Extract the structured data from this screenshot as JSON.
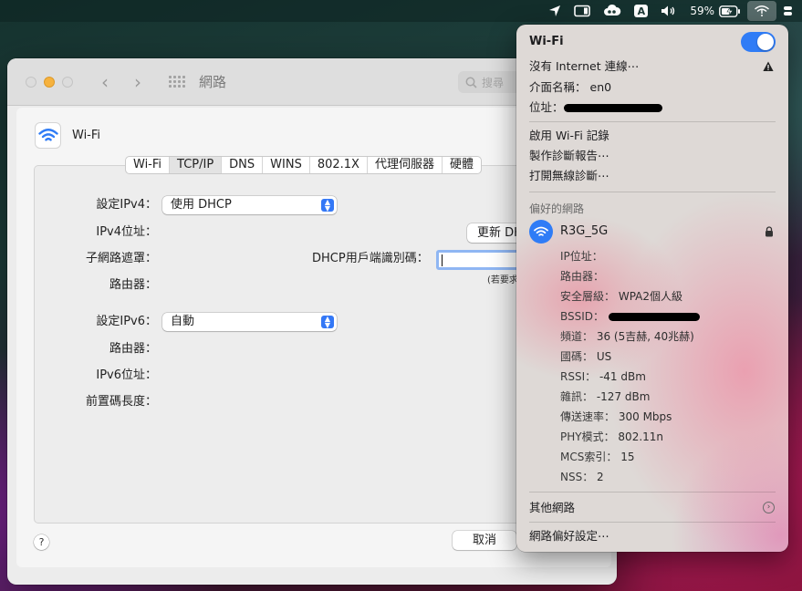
{
  "menubar": {
    "location_icon": "location-arrow-icon",
    "sidecar_icon": "sidecar-icon",
    "creative_cloud_icon": "creative-cloud-icon",
    "input_source": "A",
    "volume_icon": "speaker-icon",
    "battery_percent": "59%",
    "battery_icon": "battery-charging-icon",
    "wifi_icon": "wifi-warning-icon",
    "control_center_icon": "control-center-icon"
  },
  "window": {
    "title": "網路",
    "search_placeholder": "搜尋",
    "service_name": "Wi-Fi",
    "tabs": [
      "Wi-Fi",
      "TCP/IP",
      "DNS",
      "WINS",
      "802.1X",
      "代理伺服器",
      "硬體"
    ],
    "selected_tab": "TCP/IP",
    "ipv4_config_label": "設定IPv4：",
    "ipv4_config_value": "使用 DHCP",
    "ipv4_address_label": "IPv4位址：",
    "subnet_mask_label": "子網路遮罩：",
    "router_label": "路由器：",
    "renew_button": "更新 DHCP 租約",
    "dhcp_client_id_label": "DHCP用戶端識別碼：",
    "dhcp_client_id_value": "",
    "dhcp_hint": "(若要求)",
    "ipv6_config_label": "設定IPv6：",
    "ipv6_config_value": "自動",
    "ipv6_router_label": "路由器：",
    "ipv6_address_label": "IPv6位址：",
    "prefix_length_label": "前置碼長度：",
    "help_button": "?",
    "cancel_button": "取消"
  },
  "wifi_menu": {
    "title": "Wi-Fi",
    "enabled": true,
    "status": "沒有 Internet 連線⋯",
    "interface_label": "介面名稱：",
    "interface_value": "en0",
    "address_label": "位址：",
    "enable_logging": "啟用 Wi-Fi 記錄",
    "create_diagnostics": "製作診斷報告⋯",
    "open_wireless_diagnostics": "打開無線診斷⋯",
    "preferred_networks_header": "偏好的網路",
    "network_name": "R3G_5G",
    "details": [
      {
        "label": "IP位址：",
        "value": ""
      },
      {
        "label": "路由器：",
        "value": ""
      },
      {
        "label": "安全層級：",
        "value": "WPA2個人級"
      },
      {
        "label": "BSSID：",
        "value": ""
      },
      {
        "label": "頻道：",
        "value": "36 (5吉赫, 40兆赫)"
      },
      {
        "label": "國碼：",
        "value": "US"
      },
      {
        "label": "RSSI：",
        "value": "-41 dBm"
      },
      {
        "label": "雜訊：",
        "value": "-127 dBm"
      },
      {
        "label": "傳送速率：",
        "value": "300 Mbps"
      },
      {
        "label": "PHY模式：",
        "value": "802.11n"
      },
      {
        "label": "MCS索引：",
        "value": "15"
      },
      {
        "label": "NSS：",
        "value": "2"
      }
    ],
    "other_networks": "其他網路",
    "network_preferences": "網路偏好設定⋯",
    "accent_color": "#2f7cf6"
  }
}
